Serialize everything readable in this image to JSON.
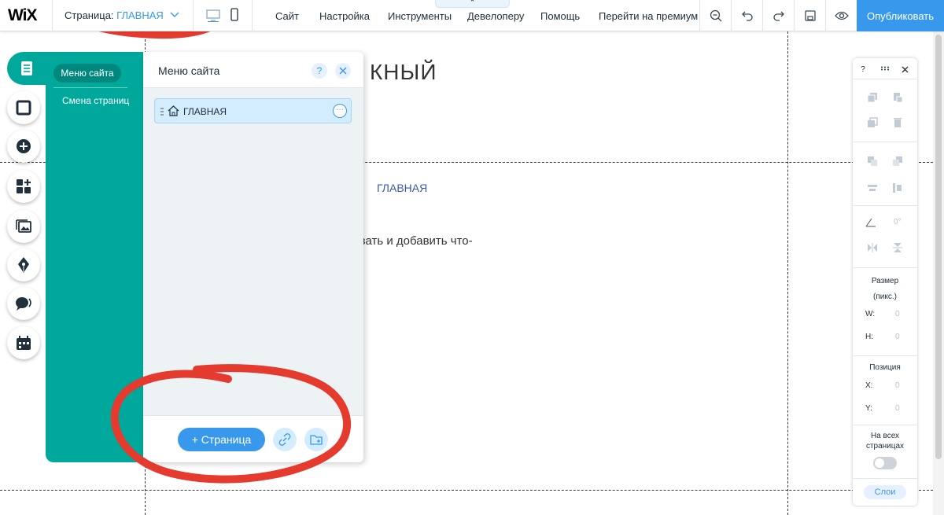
{
  "topbar": {
    "logo": "WiX",
    "page_label": "Страница:",
    "page_value": "ГЛАВНАЯ",
    "menu": [
      "Сайт",
      "Настройка",
      "Инструменты",
      "Девелоперу",
      "Помощь",
      "Перейти на премиум"
    ],
    "publish": "Опубликовать"
  },
  "site": {
    "title": "КНЫЙ",
    "link": "ГЛАВНАЯ",
    "text": "ровать и добавить что-"
  },
  "left_nav": {
    "selected": "Меню сайта",
    "item": "Смена страниц"
  },
  "pages_panel": {
    "title": "Меню сайта",
    "help": "?",
    "page_item": "ГЛАВНАЯ",
    "add_page": "+ Страница"
  },
  "inspector": {
    "help": "?",
    "angle_value": "0°",
    "size_label": "Размер",
    "size_unit": "(пикс.)",
    "w_label": "W:",
    "w_value": "0",
    "h_label": "H:",
    "h_value": "0",
    "position_label": "Позиция",
    "x_label": "X:",
    "x_value": "0",
    "y_label": "Y:",
    "y_value": "0",
    "all_pages_label": "На всех страницах",
    "layers_button": "Слои"
  },
  "colors": {
    "accent": "#3899ec",
    "teal": "#00a89c",
    "annotation": "#e53a2e"
  }
}
